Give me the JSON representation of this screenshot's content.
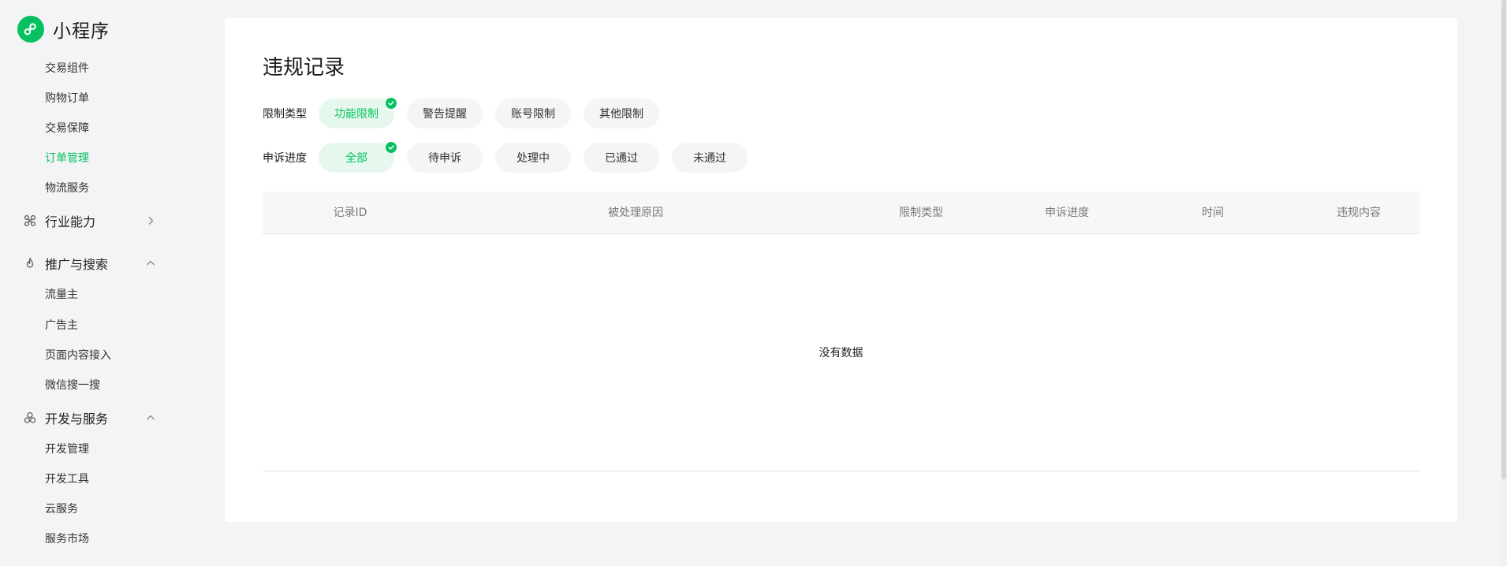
{
  "app": {
    "title": "小程序"
  },
  "sidebar": {
    "items_top": [
      {
        "label": "交易组件",
        "active": false
      },
      {
        "label": "购物订单",
        "active": false
      },
      {
        "label": "交易保障",
        "active": false
      },
      {
        "label": "订单管理",
        "active": true
      },
      {
        "label": "物流服务",
        "active": false
      }
    ],
    "group_industry": {
      "label": "行业能力",
      "icon": "hub-icon",
      "state": "collapsed"
    },
    "group_promo": {
      "label": "推广与搜索",
      "icon": "flame-icon",
      "state": "expanded"
    },
    "items_promo": [
      {
        "label": "流量主"
      },
      {
        "label": "广告主"
      },
      {
        "label": "页面内容接入"
      },
      {
        "label": "微信搜一搜"
      }
    ],
    "group_dev": {
      "label": "开发与服务",
      "icon": "cluster-icon",
      "state": "expanded"
    },
    "items_dev": [
      {
        "label": "开发管理"
      },
      {
        "label": "开发工具"
      },
      {
        "label": "云服务"
      },
      {
        "label": "服务市场"
      }
    ]
  },
  "main": {
    "title": "违规记录",
    "filters": [
      {
        "label": "限制类型",
        "options": [
          "功能限制",
          "警告提醒",
          "账号限制",
          "其他限制"
        ],
        "selected": "功能限制"
      },
      {
        "label": "申诉进度",
        "options": [
          "全部",
          "待申诉",
          "处理中",
          "已通过",
          "未通过"
        ],
        "selected": "全部"
      }
    ],
    "table": {
      "columns": [
        "记录ID",
        "被处理原因",
        "限制类型",
        "申诉进度",
        "时间",
        "违规内容"
      ],
      "rows": [],
      "empty_text": "没有数据"
    }
  },
  "colors": {
    "accent": "#07c160",
    "chip_selected_bg": "#e6f8ee",
    "chip_bg": "#f5f5f5",
    "page_bg": "#f3f4f6"
  }
}
